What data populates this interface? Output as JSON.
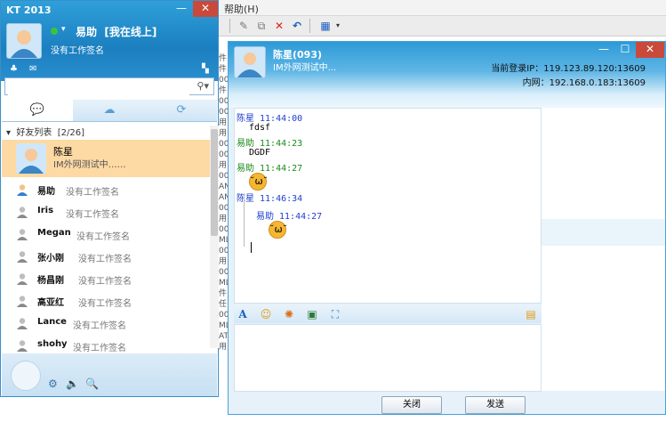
{
  "background": {
    "menu_text": "帮助(H)",
    "side_lines": [
      "件",
      "件",
      "00",
      "件",
      "00",
      "00",
      "用",
      "用",
      "00",
      "00",
      "用",
      "00",
      "AN",
      "AN",
      "00",
      "用",
      "00",
      "ML",
      "00",
      "用",
      "00",
      "ML",
      "件",
      "任",
      "00",
      "ML",
      "AT",
      "用"
    ]
  },
  "kt": {
    "title": "KT 2013",
    "min_label": "—",
    "close_label": "✕",
    "user_name": "易助",
    "user_status": "[我在线上]",
    "signature": "没有工作签名",
    "search_placeholder": "",
    "group_label": "好友列表",
    "group_count": "[2/26]",
    "selected": {
      "name": "陈星",
      "signature": "IM外网测试中……"
    },
    "contacts": [
      {
        "name": "易助",
        "signature": "没有工作签名",
        "online": true
      },
      {
        "name": "Iris",
        "signature": "没有工作签名",
        "online": false
      },
      {
        "name": "Megan",
        "signature": "没有工作签名",
        "online": false
      },
      {
        "name": "张小刚",
        "signature": "没有工作签名",
        "online": false
      },
      {
        "name": "杨昌刚",
        "signature": "没有工作签名",
        "online": false
      },
      {
        "name": "高亚红",
        "signature": "没有工作签名",
        "online": false
      },
      {
        "name": "Lance",
        "signature": "没有工作签名",
        "online": false
      },
      {
        "name": "shohy",
        "signature": "没有工作签名",
        "online": false
      }
    ]
  },
  "chat": {
    "contact_name": "陈星(093)",
    "contact_sig": "IM外网测试中...",
    "ip_label": "当前登录IP：119.123.89.120:13609",
    "lan_label": "内网：192.168.0.183:13609",
    "messages": [
      {
        "sender": "陈星 11:44:00",
        "body": "fdsf",
        "color": "#1f3fcf"
      },
      {
        "sender": "易助 11:44:23",
        "body": "DGDF",
        "color": "#1a8a1a"
      },
      {
        "sender": "易助 11:44:27",
        "body": "",
        "color": "#1a8a1a"
      },
      {
        "sender": "陈星 11:46:34",
        "body": "",
        "color": "#1f3fcf"
      },
      {
        "sender": "易助 11:44:27",
        "body": "",
        "color": "#1f3fcf"
      }
    ],
    "close_button": "关闭",
    "send_button": "发送"
  }
}
